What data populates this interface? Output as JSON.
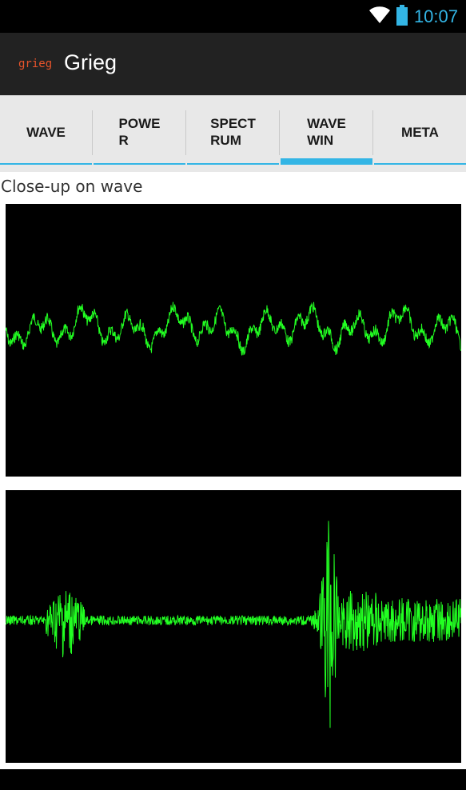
{
  "status_bar": {
    "time": "10:07",
    "wifi_icon": "wifi-icon",
    "battery_icon": "battery-icon",
    "accent_color": "#33b5e5"
  },
  "action_bar": {
    "logo_text": "grieg",
    "title": "Grieg",
    "logo_color": "#e8542b"
  },
  "tabs": [
    {
      "label": "WAVE",
      "selected": false
    },
    {
      "label": "POWE\nR",
      "selected": false
    },
    {
      "label": "SPECT\nRUM",
      "selected": false
    },
    {
      "label": "WAVE\nWIN",
      "selected": true
    },
    {
      "label": "META",
      "selected": false
    }
  ],
  "main": {
    "caption": "Close-up on wave",
    "wave_color": "#22ff22"
  },
  "chart_data": [
    {
      "type": "line",
      "name": "",
      "description_role": "close-up waveform",
      "pattern": "continuous low-amplitude oscillation with regular peaks across the window"
    },
    {
      "type": "line",
      "name": "",
      "description_role": "full waveform",
      "pattern": "burst near start, quiet mid section, large spike around 70% of width followed by sustained activity"
    }
  ]
}
